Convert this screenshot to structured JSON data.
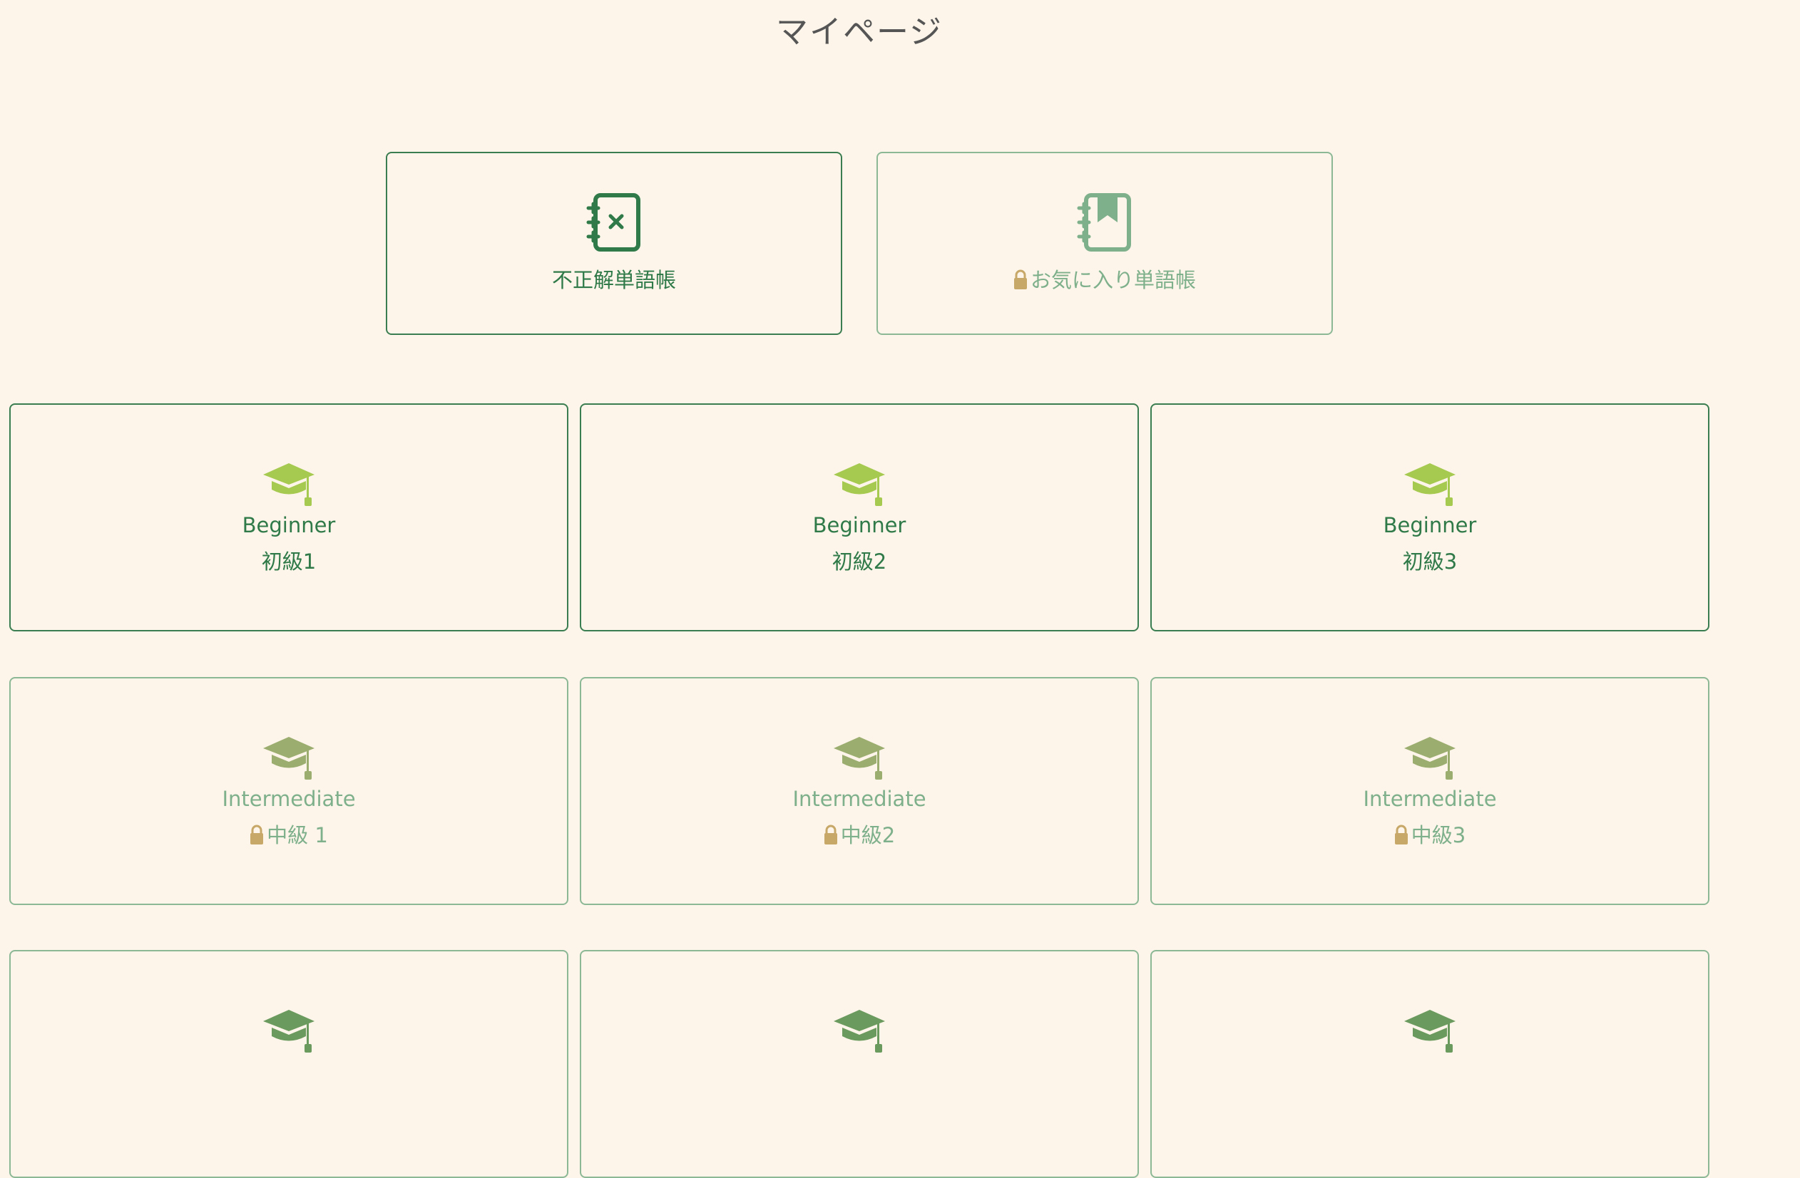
{
  "page": {
    "title": "マイページ"
  },
  "books": [
    {
      "label": "不正解単語帳",
      "icon": "notebook-x-icon",
      "locked": false
    },
    {
      "label": "お気に入り単語帳",
      "icon": "bookmark-notebook-icon",
      "locked": true
    }
  ],
  "levels": [
    {
      "en": "Beginner",
      "ja": "初級1",
      "locked": false
    },
    {
      "en": "Beginner",
      "ja": "初級2",
      "locked": false
    },
    {
      "en": "Beginner",
      "ja": "初級3",
      "locked": false
    },
    {
      "en": "Intermediate",
      "ja": "中級 1",
      "locked": true
    },
    {
      "en": "Intermediate",
      "ja": "中級2",
      "locked": true
    },
    {
      "en": "Intermediate",
      "ja": "中級3",
      "locked": true
    }
  ],
  "colors": {
    "background": "#fdf5e9",
    "primary_green": "#2f7a48",
    "muted_green": "#7fb08c",
    "cap_beginner": "#a6c94f",
    "cap_intermediate": "#9cad70",
    "cap_advanced": "#6b9a5e",
    "lock": "#c8a868"
  }
}
